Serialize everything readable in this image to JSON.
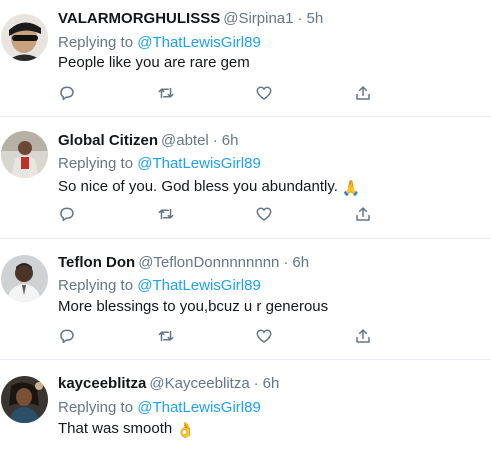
{
  "tweets": [
    {
      "display_name": "VALARMORGHULISSS",
      "handle": "@Sirpina1",
      "time": "5h",
      "replying_prefix": "Replying to",
      "replying_handle": "@ThatLewisGirl89",
      "text": "People like you are rare gem",
      "emoji": ""
    },
    {
      "display_name": "Global Citizen",
      "handle": "@abtel",
      "time": "6h",
      "replying_prefix": "Replying to",
      "replying_handle": "@ThatLewisGirl89",
      "text": "So nice of you. God bless you abundantly.",
      "emoji": "🙏"
    },
    {
      "display_name": "Teflon Don",
      "handle": "@TeflonDonnnnnnnn",
      "time": "6h",
      "replying_prefix": "Replying to",
      "replying_handle": "@ThatLewisGirl89",
      "text": "More blessings to you,bcuz u r generous",
      "emoji": ""
    },
    {
      "display_name": "kayceeblitza",
      "handle": "@Kayceeblitza",
      "time": "6h",
      "replying_prefix": "Replying to",
      "replying_handle": "@ThatLewisGirl89",
      "text": "That was smooth",
      "emoji": "👌"
    }
  ],
  "dot_separator": "·",
  "icons": {
    "reply": "reply-icon",
    "retweet": "retweet-icon",
    "like": "like-icon",
    "share": "share-icon"
  },
  "colors": {
    "link": "#1da1f2",
    "muted": "#657786",
    "text": "#14171a",
    "divider": "#e6ecf0"
  }
}
